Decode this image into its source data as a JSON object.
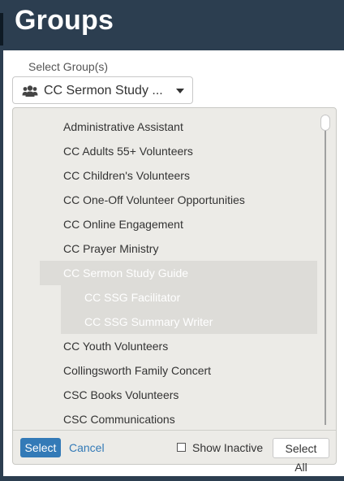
{
  "header": {
    "title": "Groups"
  },
  "selector": {
    "label": "Select Group(s)",
    "selected_text": "CC Sermon Study ...",
    "icon": "users-icon"
  },
  "list": {
    "items": [
      {
        "label": "Administrative Assistant",
        "level": 0,
        "selected": false
      },
      {
        "label": "CC Adults 55+ Volunteers",
        "level": 0,
        "selected": false
      },
      {
        "label": "CC Children's Volunteers",
        "level": 0,
        "selected": false
      },
      {
        "label": "CC One-Off Volunteer Opportunities",
        "level": 0,
        "selected": false
      },
      {
        "label": "CC Online Engagement",
        "level": 0,
        "selected": false
      },
      {
        "label": "CC Prayer Ministry",
        "level": 0,
        "selected": false
      },
      {
        "label": "CC Sermon Study Guide",
        "level": 0,
        "selected": true
      },
      {
        "label": "CC SSG Facilitator",
        "level": 1,
        "selected": true
      },
      {
        "label": "CC SSG Summary Writer",
        "level": 1,
        "selected": true
      },
      {
        "label": "CC Youth Volunteers",
        "level": 0,
        "selected": false
      },
      {
        "label": "Collingsworth Family Concert",
        "level": 0,
        "selected": false
      },
      {
        "label": "CSC Books Volunteers",
        "level": 0,
        "selected": false
      },
      {
        "label": "CSC Communications",
        "level": 0,
        "selected": false
      }
    ]
  },
  "footer": {
    "select_label": "Select",
    "cancel_label": "Cancel",
    "show_inactive_label": "Show Inactive",
    "show_inactive_checked": false,
    "select_all_label": "Select All"
  },
  "colors": {
    "header_bg": "#2c3e50",
    "panel_bg": "#ecebe7",
    "selected_row_bg": "#dddcd8",
    "primary": "#337ab7"
  }
}
